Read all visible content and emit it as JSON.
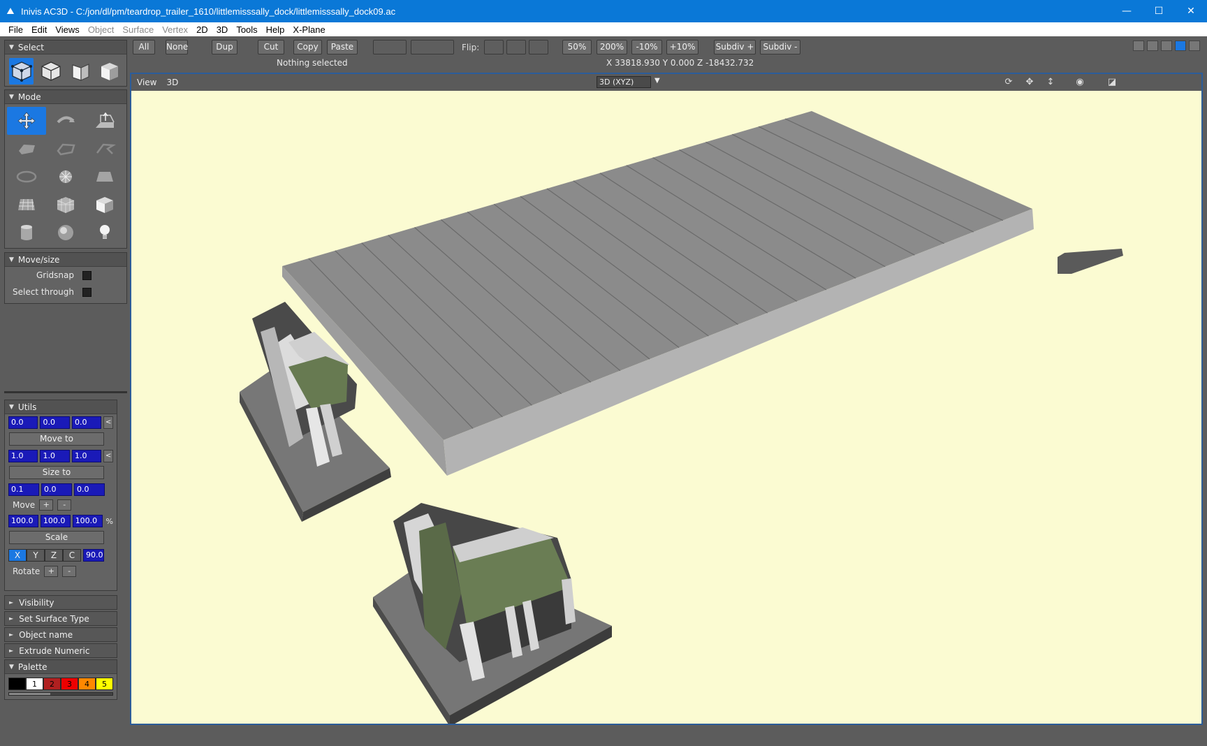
{
  "window": {
    "title": "Inivis AC3D - C:/jon/dl/pm/teardrop_trailer_1610/littlemisssally_dock/littlemisssally_dock09.ac",
    "minimize": "—",
    "maximize": "☐",
    "close": "✕"
  },
  "menu": [
    {
      "label": "File",
      "enabled": true
    },
    {
      "label": "Edit",
      "enabled": true
    },
    {
      "label": "Views",
      "enabled": true
    },
    {
      "label": "Object",
      "enabled": false
    },
    {
      "label": "Surface",
      "enabled": false
    },
    {
      "label": "Vertex",
      "enabled": false
    },
    {
      "label": "2D",
      "enabled": true
    },
    {
      "label": "3D",
      "enabled": true
    },
    {
      "label": "Tools",
      "enabled": true
    },
    {
      "label": "Help",
      "enabled": true
    },
    {
      "label": "X-Plane",
      "enabled": true
    }
  ],
  "panels": {
    "select": {
      "title": "Select",
      "active_index": 0
    },
    "mode": {
      "title": "Mode",
      "active_index": 0
    },
    "movesize": {
      "title": "Move/size",
      "gridsnap": "Gridsnap",
      "select_through": "Select through"
    },
    "utils": {
      "title": "Utils",
      "pos": [
        "0.0",
        "0.0",
        "0.0"
      ],
      "move_to": "Move to",
      "size": [
        "1.0",
        "1.0",
        "1.0"
      ],
      "size_to": "Size to",
      "step": [
        "0.1",
        "0.0",
        "0.0"
      ],
      "move": "Move",
      "plus": "+",
      "minus": "-",
      "less": "<",
      "scale_vals": [
        "100.0",
        "100.0",
        "100.0"
      ],
      "percent": "%",
      "scale": "Scale",
      "axes": [
        "X",
        "Y",
        "Z",
        "C"
      ],
      "angle": "90.0",
      "rotate": "Rotate"
    },
    "collapsed": [
      "Visibility",
      "Set Surface Type",
      "Object name",
      "Extrude Numeric"
    ],
    "palette": {
      "title": "Palette",
      "swatches": [
        {
          "label": "",
          "color": "#000000",
          "text": "#ffffff"
        },
        {
          "label": "1",
          "color": "#ffffff",
          "text": "#000000"
        },
        {
          "label": "2",
          "color": "#b02020",
          "text": "#000000"
        },
        {
          "label": "3",
          "color": "#ee0000",
          "text": "#000000"
        },
        {
          "label": "4",
          "color": "#ff8800",
          "text": "#000000"
        },
        {
          "label": "5",
          "color": "#ffff00",
          "text": "#000000"
        }
      ]
    }
  },
  "toolbar": {
    "all": "All",
    "none": "None",
    "dup": "Dup",
    "cut": "Cut",
    "copy": "Copy",
    "paste": "Paste",
    "flip": "Flip:",
    "z50": "50%",
    "z200": "200%",
    "m10": "-10%",
    "p10": "+10%",
    "subdiv_plus": "Subdiv +",
    "subdiv_minus": "Subdiv -",
    "status": "Nothing selected",
    "coords": "X 33818.930 Y 0.000 Z -18432.732"
  },
  "viewport": {
    "view_menu": "View",
    "mode_menu": "3D",
    "projection": "3D (XYZ)",
    "background": "#fbfbd2"
  },
  "icons": {
    "select": [
      "select-vertices-icon",
      "select-objects-icon",
      "select-surfaces-icon",
      "select-groups-icon"
    ],
    "mode": [
      "move-icon",
      "rotate-icon",
      "extrude-icon",
      "polygon-icon",
      "polyline-icon",
      "line-icon",
      "ellipse-icon",
      "circle-icon",
      "rectangle-icon",
      "mesh-icon",
      "box-icon",
      "cube-icon",
      "cylinder-icon",
      "sphere-icon",
      "light-icon"
    ],
    "viewport": [
      "rotate-view-icon",
      "pan-view-icon",
      "zoom-view-icon",
      "eye-icon",
      "maximize-view-icon"
    ],
    "window": [
      "app-icon"
    ]
  }
}
